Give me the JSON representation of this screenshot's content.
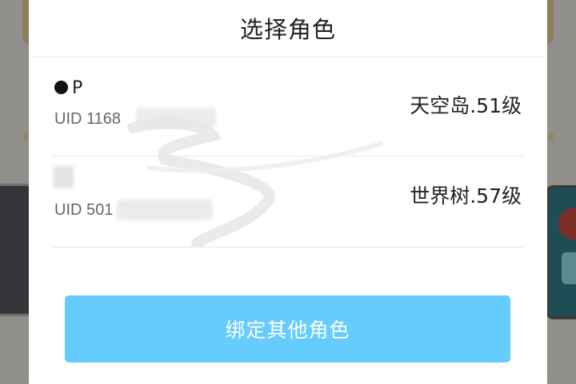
{
  "dialog": {
    "title": "选择角色",
    "roles": [
      {
        "name": "P",
        "uid": "UID 1168",
        "server": "天空岛.51级"
      },
      {
        "name": "",
        "uid": "UID 501",
        "server": "世界树.57级"
      }
    ],
    "bind_button": "绑定其他角色"
  },
  "colors": {
    "button": "#66cbfd",
    "overlay": "#8f8f8f",
    "dialog_bg": "#ffffff"
  }
}
